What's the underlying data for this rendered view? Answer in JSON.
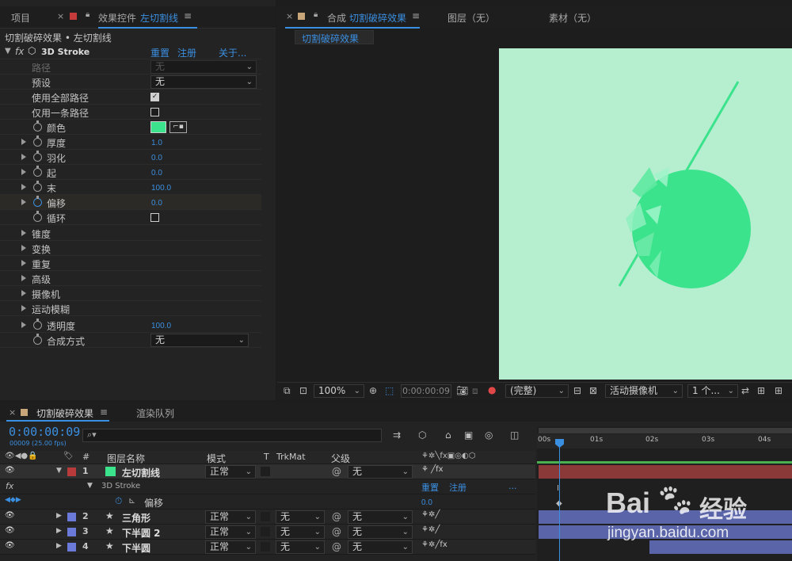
{
  "top_panel_tabs": {
    "project": "项目",
    "effect_controls": "效果控件",
    "effect_layer": "左切割线",
    "comp": "合成",
    "comp_name": "切割破碎效果",
    "layer": "图层（无）",
    "footage": "素材（无）"
  },
  "effect_controls": {
    "breadcrumb": "切割破碎效果 • 左切割线",
    "effect_name": "3D Stroke",
    "reset": "重置",
    "register": "注册",
    "about": "关于...",
    "props": [
      {
        "label": "路径",
        "value": "无",
        "kind": "dd_disabled"
      },
      {
        "label": "预设",
        "value": "无",
        "kind": "dd"
      },
      {
        "label": "使用全部路径",
        "value": true,
        "kind": "cb"
      },
      {
        "label": "仅用一条路径",
        "value": false,
        "kind": "cb"
      },
      {
        "label": "颜色",
        "kind": "color",
        "color": "#3be38c"
      },
      {
        "label": "厚度",
        "value": "1.0",
        "kind": "num"
      },
      {
        "label": "羽化",
        "value": "0.0",
        "kind": "num"
      },
      {
        "label": "起",
        "value": "0.0",
        "kind": "num"
      },
      {
        "label": "末",
        "value": "100.0",
        "kind": "num"
      },
      {
        "label": "偏移",
        "value": "0.0",
        "kind": "num"
      },
      {
        "label": "循环",
        "value": false,
        "kind": "cb"
      },
      {
        "label": "锥度",
        "kind": "group"
      },
      {
        "label": "变换",
        "kind": "group"
      },
      {
        "label": "重复",
        "kind": "group"
      },
      {
        "label": "高级",
        "kind": "group"
      },
      {
        "label": "摄像机",
        "kind": "group"
      },
      {
        "label": "运动模糊",
        "kind": "group"
      },
      {
        "label": "透明度",
        "value": "100.0",
        "kind": "num"
      },
      {
        "label": "合成方式",
        "value": "无",
        "kind": "dd"
      }
    ]
  },
  "viewer": {
    "tab_label": "切割破碎效果",
    "bg_color": "#b6eed0",
    "shape_color": "#3be38c",
    "zoom": "100%",
    "timecode": "0:00:00:09",
    "quality": "(完整)",
    "camera": "活动摄像机",
    "views": "1 个..."
  },
  "timeline": {
    "comp_tab": "切割破碎效果",
    "render_tab": "渲染队列",
    "timecode": "0:00:00:09",
    "frame_info": "00009 (25.00 fps)",
    "col_headers": {
      "num": "#",
      "name": "图层名称",
      "mode": "模式",
      "t": "T",
      "trkmat": "TrkMat",
      "parent": "父级"
    },
    "ruler": [
      "00s",
      "01s",
      "02s",
      "03s",
      "04s"
    ],
    "sub_effect": "3D Stroke",
    "sub_reset": "重置",
    "sub_register": "注册",
    "sub_more": "...",
    "offset_label": "偏移",
    "offset_value": "0.0",
    "layers": [
      {
        "num": "1",
        "name": "左切割线",
        "mode": "正常",
        "trkmat": "",
        "parent": "无",
        "color": "#b83a3a"
      },
      {
        "num": "2",
        "name": "三角形",
        "mode": "正常",
        "trkmat": "无",
        "parent": "无",
        "color": "#6b7ad8"
      },
      {
        "num": "3",
        "name": "下半圆 2",
        "mode": "正常",
        "trkmat": "无",
        "parent": "无",
        "color": "#6b7ad8"
      },
      {
        "num": "4",
        "name": "下半圆",
        "mode": "正常",
        "trkmat": "无",
        "parent": "无",
        "color": "#6b7ad8"
      }
    ]
  },
  "watermark": {
    "brand": "Bai",
    "brand2": "经验",
    "url": "jingyan.baidu.com"
  }
}
